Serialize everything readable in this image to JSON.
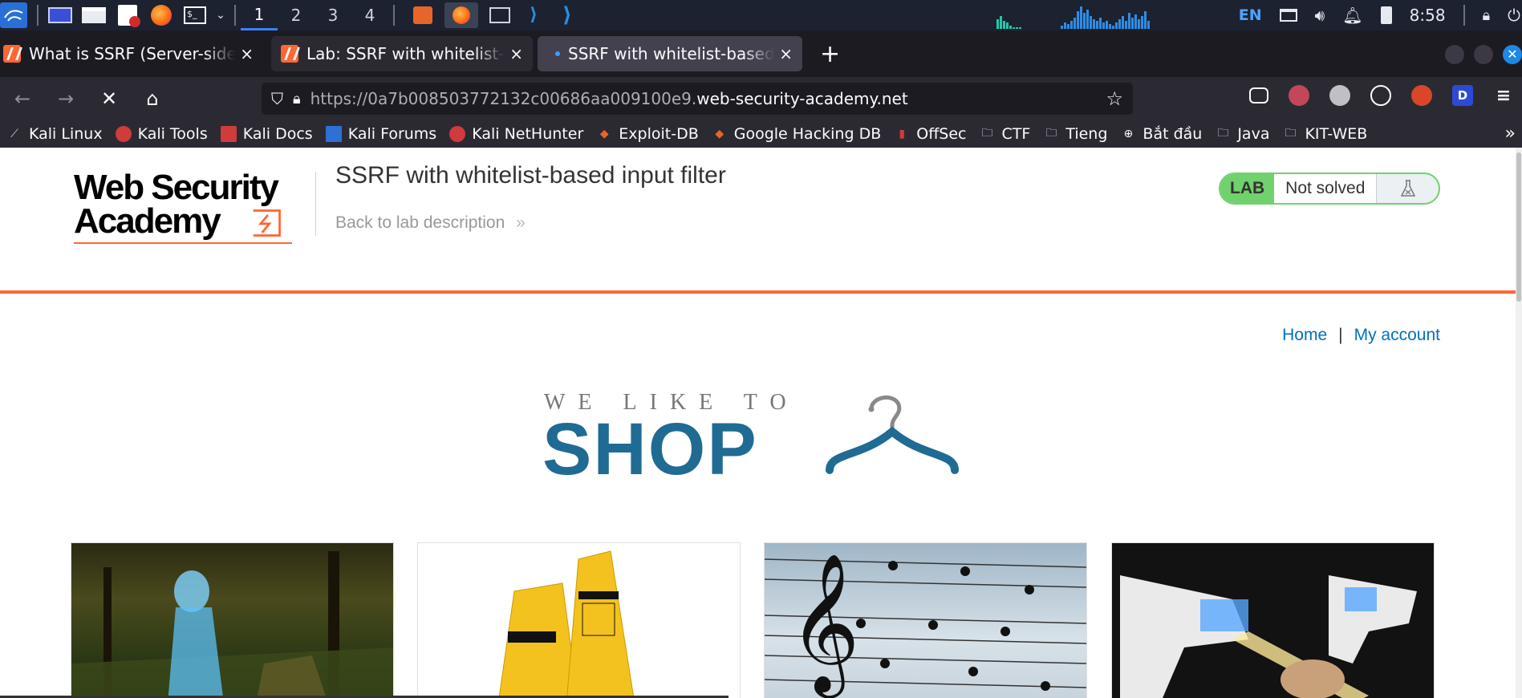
{
  "taskbar": {
    "workspaces": [
      "1",
      "2",
      "3",
      "4"
    ],
    "language": "EN",
    "clock": "8:58"
  },
  "tabs": [
    {
      "title": "What is SSRF (Server-side",
      "close": "×"
    },
    {
      "title": "Lab: SSRF with whitelist-",
      "close": "×"
    },
    {
      "title": "SSRF with whitelist-based",
      "close": "×"
    }
  ],
  "new_tab_label": "+",
  "nav": {
    "url_prefix": "https://0a7b008503772132c00686aa009100e9.",
    "url_domain": "web-security-academy.net",
    "profile_letter": "D"
  },
  "bookmarks": [
    {
      "label": "Kali Linux",
      "icon": "kali-icon"
    },
    {
      "label": "Kali Tools",
      "icon": "kali-tools-icon"
    },
    {
      "label": "Kali Docs",
      "icon": "kali-docs-icon"
    },
    {
      "label": "Kali Forums",
      "icon": "kali-forums-icon"
    },
    {
      "label": "Kali NetHunter",
      "icon": "nethunter-icon"
    },
    {
      "label": "Exploit-DB",
      "icon": "exploitdb-icon"
    },
    {
      "label": "Google Hacking DB",
      "icon": "ghdb-icon"
    },
    {
      "label": "OffSec",
      "icon": "offsec-icon"
    },
    {
      "label": "CTF",
      "icon": "folder-icon"
    },
    {
      "label": "Tieng",
      "icon": "folder-icon"
    },
    {
      "label": "Bắt đầu",
      "icon": "globe-icon"
    },
    {
      "label": "Java",
      "icon": "folder-icon"
    },
    {
      "label": "KIT-WEB",
      "icon": "folder-icon"
    }
  ],
  "page": {
    "logo_line1": "Web Security",
    "logo_line2": "Academy",
    "lab_title": "SSRF with whitelist-based input filter",
    "back_link": "Back to lab description",
    "back_chevron": "»",
    "lab_badge": "LAB",
    "lab_status": "Not solved",
    "home_link": "Home",
    "separator": "|",
    "account_link": "My account",
    "shop_small": "WE LIKE TO",
    "shop_big": "SHOP"
  },
  "colors": {
    "accent_orange": "#ff6633",
    "link_blue": "#0071bc",
    "lab_green": "#70d16d",
    "shop_blue": "#1f6b93"
  }
}
